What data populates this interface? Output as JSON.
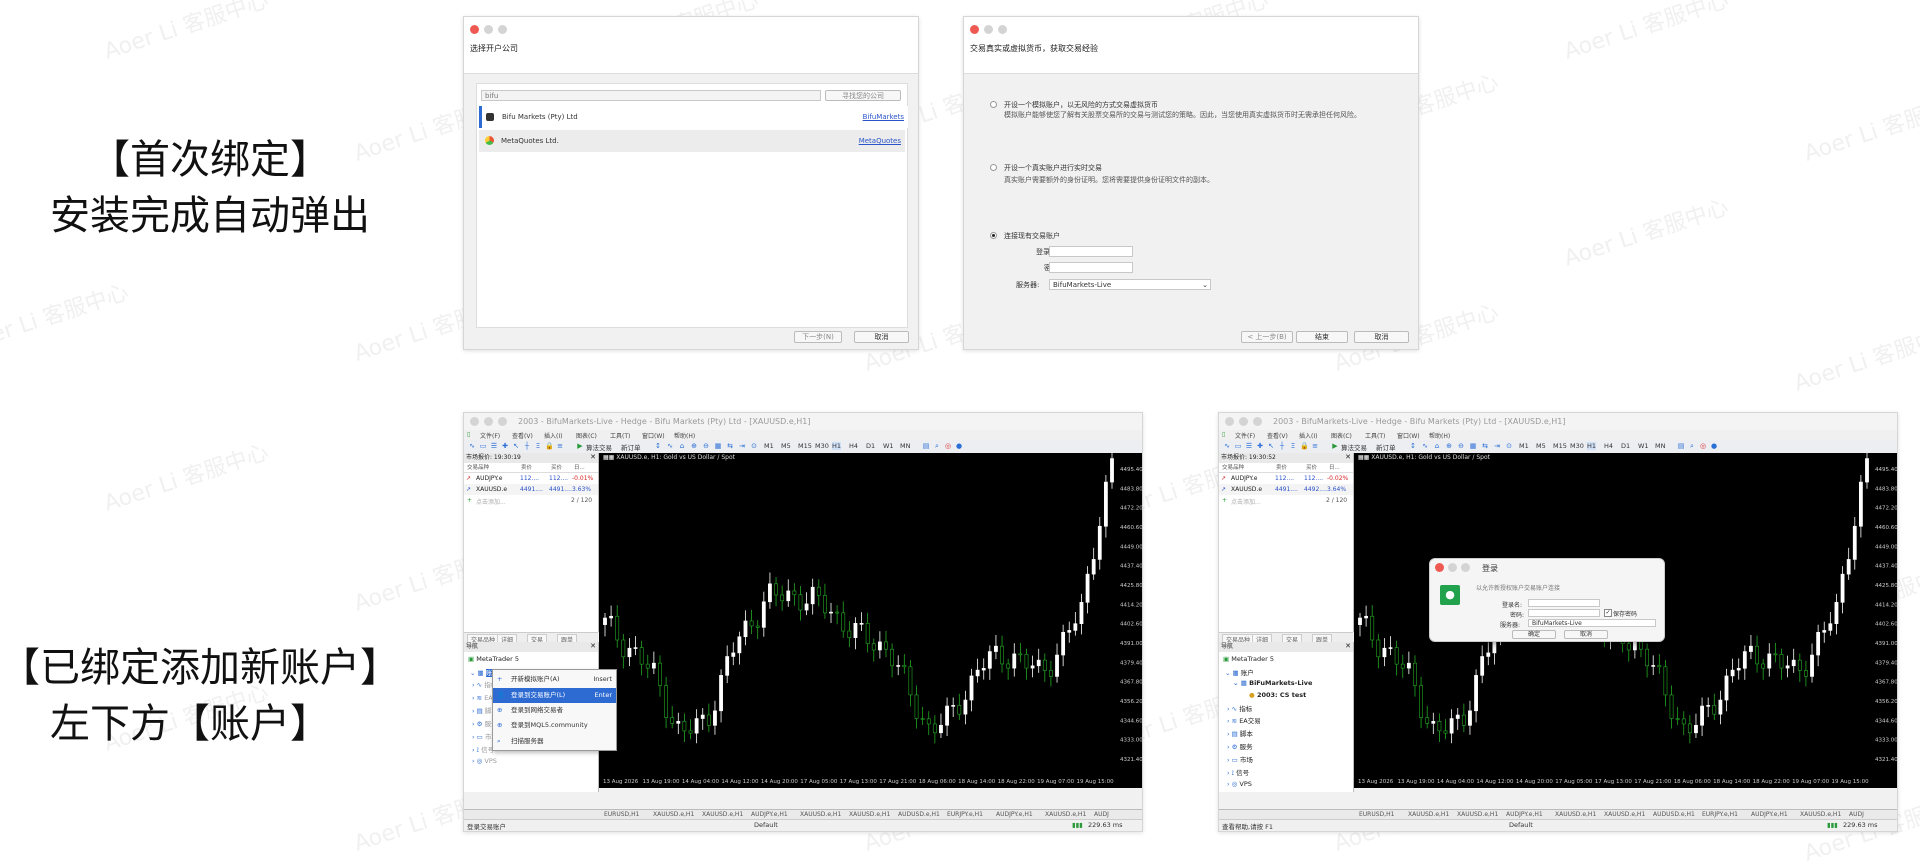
{
  "captions": {
    "first_line1": "【首次绑定】",
    "first_line2": "安装完成自动弹出",
    "bound_line1": "【已绑定添加新账户】",
    "bound_line2": "左下方【账户】"
  },
  "watermark": "Aoer Li 客服中心",
  "broker_dialog": {
    "header": "选择开户公司",
    "search_value": "bifu",
    "find_button": "寻找您的公司",
    "companies": [
      {
        "name": "Bifu Markets (Pty) Ltd",
        "link": "BifuMarkets"
      },
      {
        "name": "MetaQuotes Ltd.",
        "link": "MetaQuotes"
      }
    ],
    "next_button": "下一步(N)",
    "cancel_button": "取消"
  },
  "account_dialog": {
    "header": "交易真实或虚拟货币，获取交易经验",
    "option1_title": "开设一个模拟账户，以无风险的方式交易虚拟货币",
    "option1_desc": "模拟账户能够使您了解有关股票交易所的交易与测试您的策略。因此，当您使用真实虚拟货币时无需承担任何风险。",
    "option2_title": "开设一个真实账户进行实时交易",
    "option2_desc": "真实账户需要额外的身份证明。您将需要提供身份证明文件的副本。",
    "option3_title": "连接现有交易账户",
    "login_label": "登录名:",
    "password_label": "密码:",
    "server_label": "服务器:",
    "server_value": "BifuMarkets-Live",
    "back_button": "< 上一步(B)",
    "finish_button": "结束",
    "cancel_button": "取消"
  },
  "mt5_common": {
    "title": "2003 - BifuMarkets-Live - Hedge - Bifu Markets (Pty) Ltd - [XAUUSD.e,H1]",
    "menu": [
      "文件(F)",
      "查看(V)",
      "插入(I)",
      "图表(C)",
      "工具(T)",
      "窗口(W)",
      "帮助(H)"
    ],
    "algo_label": "算法交易",
    "new_order_label": "新订单",
    "timeframes": [
      "M1",
      "M5",
      "M15",
      "M30",
      "H1",
      "H4",
      "D1",
      "W1",
      "MN"
    ],
    "mw_cols": [
      "交易品种",
      "卖价",
      "买价",
      "日..."
    ],
    "chart_header": "XAUUSD.e, H1:  Gold vs US Dollar / Spot",
    "price_ticks": [
      "4495.40",
      "4483.80",
      "4472.20",
      "4460.60",
      "4449.00",
      "4437.40",
      "4425.80",
      "4414.20",
      "4402.60",
      "4391.00",
      "4379.40",
      "4367.80",
      "4356.20",
      "4344.60",
      "4333.00",
      "4321.40"
    ],
    "time_ticks": [
      "13 Aug 2026",
      "13 Aug 19:00",
      "14 Aug 04:00",
      "14 Aug 12:00",
      "14 Aug 20:00",
      "17 Aug 05:00",
      "17 Aug 13:00",
      "17 Aug 21:00",
      "18 Aug 06:00",
      "18 Aug 14:00",
      "18 Aug 22:00",
      "19 Aug 07:00",
      "19 Aug 15:00"
    ],
    "chart_tabs": [
      "EURUSD,H1",
      "XAUUSD.e,H1",
      "XAUUSD.e,H1",
      "AUDJPY.e,H1",
      "XAUUSD.e,H1",
      "XAUUSD.e,H1",
      "AUDUSD.e,H1",
      "EURJPY.e,H1",
      "AUDJPY.e,H1",
      "XAUUSD.e,H1",
      "AUDJ"
    ],
    "panel_tabs": [
      "交易品种",
      "详细",
      "交易",
      "跟单"
    ],
    "add_symbol": "点击添加...",
    "symbol_count": "2 / 120",
    "nav_title": "导航",
    "nav_root": "MetaTrader 5",
    "status_default": "Default",
    "status_ping": "229.63 ms"
  },
  "mt5_left": {
    "mw_title": "市场报价: 19:30:19",
    "rows": [
      {
        "symbol": "AUDJPY.e",
        "bid": "112....",
        "ask": "112....",
        "change": "-0.01%"
      },
      {
        "symbol": "XAUUSD.e",
        "bid": "4491....",
        "ask": "4491....",
        "change": "3.63%"
      }
    ],
    "nav_items": [
      "账户",
      "指标",
      "EA交易",
      "脚本",
      "服务",
      "市场",
      "信号",
      "VPS"
    ],
    "context_menu": [
      {
        "label": "开新模拟账户(A)",
        "shortcut": "Insert"
      },
      {
        "label": "登录到交易账户(L)",
        "shortcut": "Enter"
      },
      {
        "label": "登录到网络交易者",
        "shortcut": ""
      },
      {
        "label": "登录到MQL5.community",
        "shortcut": ""
      },
      {
        "label": "扫描服务器",
        "shortcut": ""
      }
    ],
    "status_left": "登录交易账户"
  },
  "mt5_right": {
    "mw_title": "市场报价: 19:30:52",
    "rows": [
      {
        "symbol": "AUDJPY.e",
        "bid": "112....",
        "ask": "112....",
        "change": "-0.02%"
      },
      {
        "symbol": "XAUUSD.e",
        "bid": "4491....",
        "ask": "4492....",
        "change": "3.64%"
      }
    ],
    "nav_items": [
      "账户",
      "BiFuMarkets-Live",
      "2003: CS test",
      "指标",
      "EA交易",
      "脚本",
      "服务",
      "市场",
      "信号",
      "VPS"
    ],
    "status_left": "查看帮助,请按 F1",
    "login_dialog": {
      "title": "登录",
      "desc": "以允许新授权账户交易账户连接",
      "login_label": "登录名:",
      "password_label": "密码:",
      "save_label": "保存密码",
      "server_label": "服务器:",
      "server_value": "BifuMarkets-Live",
      "ok_button": "确定",
      "cancel_button": "取消"
    }
  },
  "colors": {
    "bull": "#ffffff",
    "bear": "#22aa22",
    "accent": "#2d6bd2",
    "close_red": "#ee5a52"
  }
}
